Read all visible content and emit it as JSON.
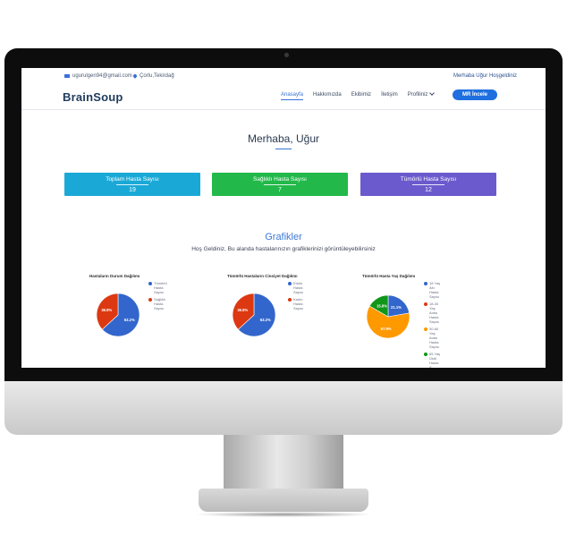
{
  "topbar": {
    "email": "ugurulgen94@gmail.com",
    "location": "Çorlu,Tekirdağ",
    "greeting": "Merhaba Uğur Hoşgeldiniz"
  },
  "navbar": {
    "logo": "BrainSoup",
    "items": [
      "Anasayfa",
      "Hakkımızda",
      "Ekibimiz",
      "İletişim",
      "Profiliniz"
    ],
    "active_index": 0,
    "cta_label": "MR İncele"
  },
  "welcome": {
    "title": "Merhaba, Uğur"
  },
  "cards": [
    {
      "label": "Toplam Hasta Sayısı",
      "value": "19",
      "color": "#1aa9d6"
    },
    {
      "label": "Sağlıklı Hasta Sayısı",
      "value": "7",
      "color": "#22b94a"
    },
    {
      "label": "Tümörlü Hasta Sayısı",
      "value": "12",
      "color": "#6a5acd"
    }
  ],
  "graphs": {
    "title": "Grafikler",
    "subtitle": "Hoş Geldiniz, Bu alanda hastalarınızın grafiklerinizi görüntüleyebilirsiniz"
  },
  "chart_data": [
    {
      "type": "pie",
      "title": "Hastaların Durum Dağılımı",
      "slices": [
        {
          "label": "Tümörlü Hasta Sayısı",
          "value": 63.2,
          "display": "63.2%",
          "color": "#3366cc"
        },
        {
          "label": "Sağlıklı Hasta Sayısı",
          "value": 36.8,
          "display": "36.8%",
          "color": "#dc3912"
        }
      ],
      "legend": "right"
    },
    {
      "type": "pie",
      "title": "Tümörlü Hastaların Cinsiyet Dağılımı",
      "slices": [
        {
          "label": "Erkek Hasta Sayısı",
          "value": 63.2,
          "display": "63.2%",
          "color": "#3366cc"
        },
        {
          "label": "Kadın Hasta Sayısı",
          "value": 36.8,
          "display": "36.8%",
          "color": "#dc3912"
        }
      ],
      "legend": "right"
    },
    {
      "type": "pie",
      "title": "Tümörlü Hasta Yaş Dağılımı",
      "slices": [
        {
          "label": "18 Yaş Altı Hasta Sayısı",
          "value": 21.1,
          "display": "21.1%",
          "color": "#3366cc"
        },
        {
          "label": "18-30 Yaş Arası Hasta Sayısı",
          "value": 0,
          "display": "",
          "color": "#dc3912"
        },
        {
          "label": "30-60 Yaş Arası Hasta Sayısı",
          "value": 57.9,
          "display": "57.9%",
          "color": "#ff9900"
        },
        {
          "label": "65 Yaş Üstü Hasta S...",
          "value": 15.8,
          "display": "15.8%",
          "color": "#109618"
        }
      ],
      "legend": "right"
    }
  ]
}
